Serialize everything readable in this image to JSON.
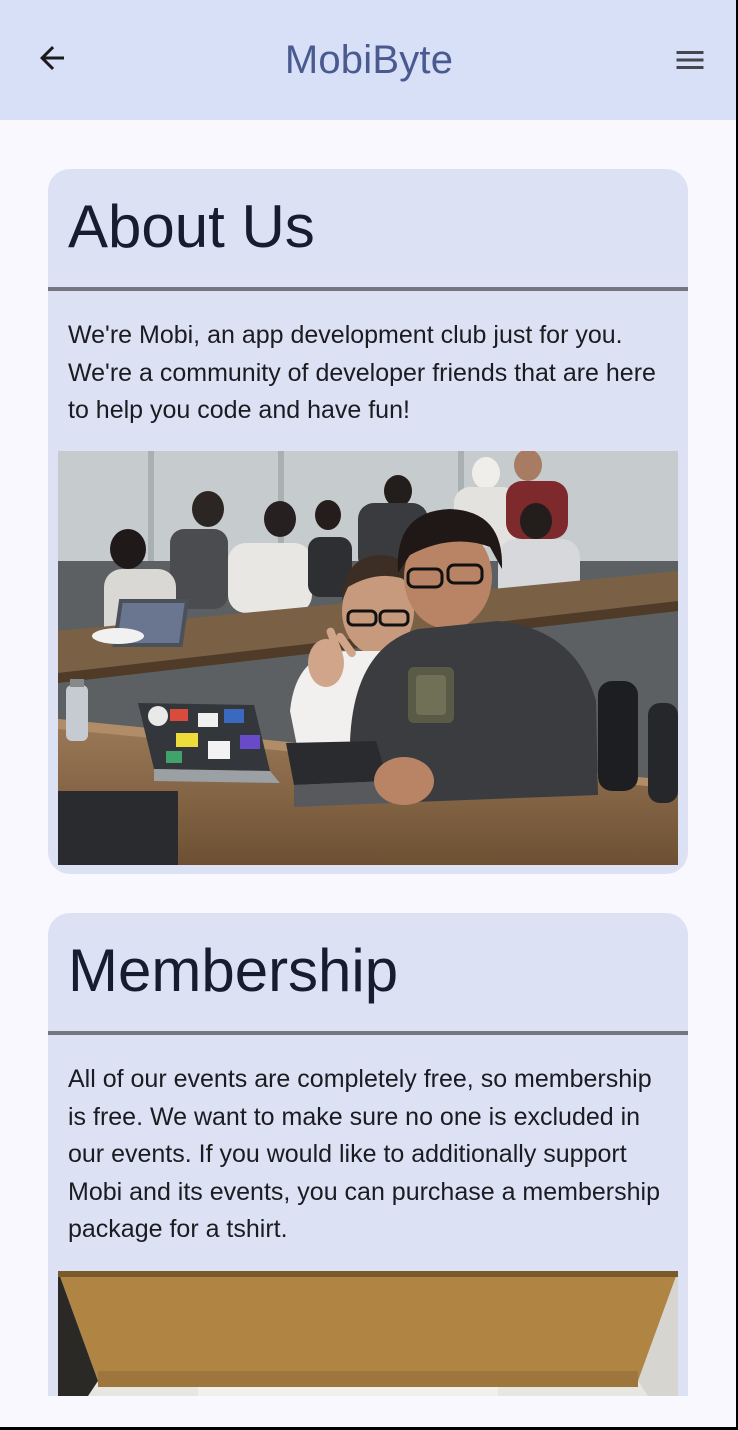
{
  "app_bar": {
    "title": "MobiByte",
    "back_icon": "arrow-back-icon",
    "menu_icon": "hamburger-menu-icon",
    "background": "#d8e0f8",
    "title_color": "#4a5a8f"
  },
  "sections": [
    {
      "title": "About Us",
      "body": "We're Mobi, an app development club just for you. We're a community of developer friends that are here to help you code and have fun!"
    },
    {
      "title": "Membership",
      "body": "All of our events are completely free, so membership is free. We want to make sure no one is excluded in our events. If you would like to additionally support Mobi and its events, you can purchase a membership package for a tshirt."
    }
  ],
  "colors": {
    "card_background": "#dce1f4",
    "divider": "#74777f",
    "page_background": "#faf8ff"
  }
}
